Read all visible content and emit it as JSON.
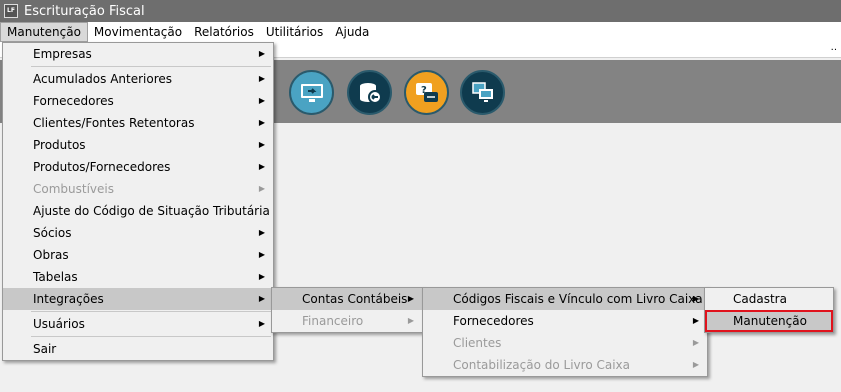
{
  "window": {
    "icon_text": "LF",
    "title": "Escrituração Fiscal"
  },
  "menubar": {
    "items": [
      {
        "label": "Manutenção"
      },
      {
        "label": "Movimentação"
      },
      {
        "label": "Relatórios"
      },
      {
        "label": "Utilitários"
      },
      {
        "label": "Ajuda"
      }
    ]
  },
  "subbar": {
    "trailing": ".."
  },
  "toolbar": {
    "buttons": [
      {
        "icon": "monitor-arrow-icon",
        "color": "#4aa3c3"
      },
      {
        "icon": "database-back-icon",
        "color": "#0f3b4e"
      },
      {
        "icon": "help-chat-icon",
        "color": "#f0a020"
      },
      {
        "icon": "remote-screen-icon",
        "color": "#0f3b4e"
      }
    ]
  },
  "menu_main": {
    "items": [
      {
        "label": "Empresas"
      },
      {
        "label": "Acumulados Anteriores"
      },
      {
        "label": "Fornecedores"
      },
      {
        "label": "Clientes/Fontes Retentoras"
      },
      {
        "label": "Produtos"
      },
      {
        "label": "Produtos/Fornecedores"
      },
      {
        "label": "Combustíveis"
      },
      {
        "label": "Ajuste do Código de Situação Tributária"
      },
      {
        "label": "Sócios"
      },
      {
        "label": "Obras"
      },
      {
        "label": "Tabelas"
      },
      {
        "label": "Integrações"
      },
      {
        "label": "Usuários"
      },
      {
        "label": "Sair"
      }
    ]
  },
  "menu_integracoes": {
    "items": [
      {
        "label": "Contas Contábeis"
      },
      {
        "label": "Financeiro"
      }
    ]
  },
  "menu_contas_contabeis": {
    "items": [
      {
        "label": "Códigos Fiscais e Vínculo com Livro Caixa"
      },
      {
        "label": "Fornecedores"
      },
      {
        "label": "Clientes"
      },
      {
        "label": "Contabilização do Livro Caixa"
      }
    ]
  },
  "menu_codigos_fiscais": {
    "items": [
      {
        "label": "Cadastra"
      },
      {
        "label": "Manutenção"
      }
    ]
  },
  "colors": {
    "highlight_outline": "#e0131d",
    "toolbar_bg": "#838383",
    "titlebar_bg": "#6e6e6e"
  }
}
